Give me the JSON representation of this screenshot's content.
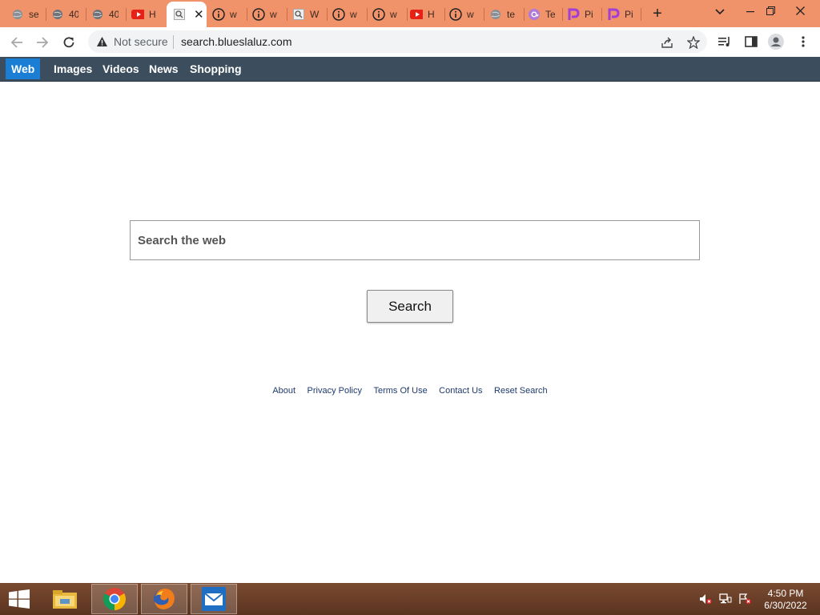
{
  "browser": {
    "tabs": [
      {
        "title": "se",
        "icon": "globe-icon"
      },
      {
        "title": "40",
        "icon": "globe-icon"
      },
      {
        "title": "40",
        "icon": "globe-icon"
      },
      {
        "title": "H",
        "icon": "youtube-icon"
      },
      {
        "title": "",
        "icon": "search-favicon",
        "active": true
      },
      {
        "title": "w",
        "icon": "info-icon"
      },
      {
        "title": "w",
        "icon": "info-icon"
      },
      {
        "title": "W",
        "icon": "search-favicon"
      },
      {
        "title": "w",
        "icon": "info-icon"
      },
      {
        "title": "w",
        "icon": "info-icon"
      },
      {
        "title": "H",
        "icon": "youtube-icon"
      },
      {
        "title": "w",
        "icon": "info-icon"
      },
      {
        "title": "te",
        "icon": "globe-icon"
      },
      {
        "title": "Te",
        "icon": "at-icon"
      },
      {
        "title": "Pi",
        "icon": "p-icon"
      },
      {
        "title": "Pi",
        "icon": "p-icon"
      }
    ],
    "security_label": "Not secure",
    "url": "search.blueslaluz.com"
  },
  "site_nav": {
    "items": [
      "Web",
      "Images",
      "Videos",
      "News",
      "Shopping"
    ],
    "active": "Web"
  },
  "search": {
    "placeholder": "Search the web",
    "button_label": "Search"
  },
  "footer": {
    "links": [
      "About",
      "Privacy Policy",
      "Terms Of Use",
      "Contact Us",
      "Reset Search"
    ]
  },
  "taskbar": {
    "time": "4:50 PM",
    "date": "6/30/2022"
  },
  "colors": {
    "tabstrip": "#f0926a",
    "site_nav": "#3c4e5e",
    "nav_active": "#1a7fd4",
    "footer_link": "#1e3a6e"
  }
}
